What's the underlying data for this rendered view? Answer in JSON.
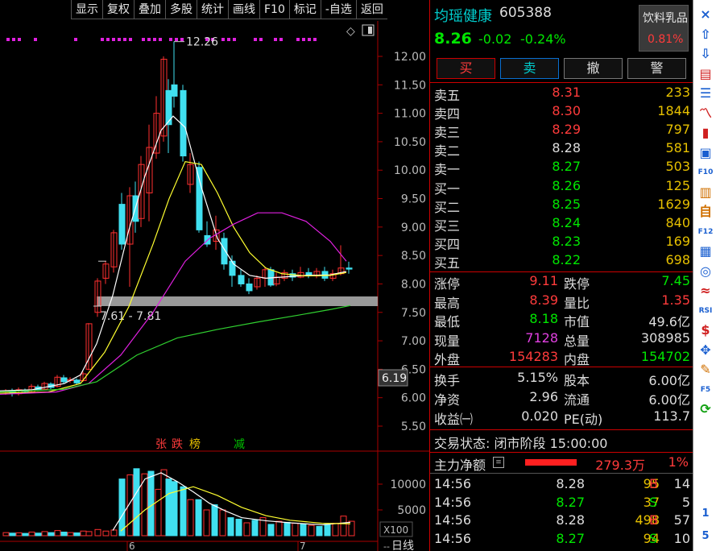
{
  "toolbar": {
    "items": [
      "显示",
      "复权",
      "叠加",
      "多股",
      "统计",
      "画线",
      "F10",
      "标记",
      "-自选",
      "返回"
    ]
  },
  "chart": {
    "price_ticks": [
      "12.00",
      "11.50",
      "11.00",
      "10.50",
      "10.00",
      "9.50",
      "9.00",
      "8.50",
      "8.00",
      "7.50",
      "7.00",
      "6.50",
      "6.00",
      "5.50"
    ],
    "high_label": "12.26",
    "range_label": "7.61 - 7.81",
    "current_tag": "6.19",
    "vol_ticks": [
      "10000",
      "5000"
    ],
    "vol_unit": "X100",
    "month_labels": [
      "6",
      "7"
    ],
    "period": "日线",
    "corner": "--",
    "markers": [
      {
        "text": "张",
        "color": "#ff3b3b"
      },
      {
        "text": "跌",
        "color": "#ff3b3b"
      },
      {
        "text": "榜",
        "color": "#e6c000"
      },
      {
        "text": "减",
        "color": "#00c000"
      }
    ]
  },
  "quote": {
    "name": "均瑶健康",
    "code": "605388",
    "industry": "饮料乳品",
    "industry_pct": "0.81%",
    "price": "8.26",
    "change": "-0.02",
    "change_pct": "-0.24%",
    "buttons": [
      {
        "label": "买",
        "color": "#ff3b3b",
        "border": "#c00"
      },
      {
        "label": "卖",
        "color": "#00cccc",
        "border": "#0a6fd0"
      },
      {
        "label": "撤",
        "color": "#ddd",
        "border": "#777"
      },
      {
        "label": "警",
        "color": "#ddd",
        "border": "#777"
      }
    ],
    "sell": [
      {
        "label": "卖五",
        "price": "8.31",
        "vol": "233",
        "pc": "#ff3b3b"
      },
      {
        "label": "卖四",
        "price": "8.30",
        "vol": "1844",
        "pc": "#ff3b3b"
      },
      {
        "label": "卖三",
        "price": "8.29",
        "vol": "797",
        "pc": "#ff3b3b"
      },
      {
        "label": "卖二",
        "price": "8.28",
        "vol": "581",
        "pc": "#ddd"
      },
      {
        "label": "卖一",
        "price": "8.27",
        "vol": "503",
        "pc": "#00e600"
      }
    ],
    "buy": [
      {
        "label": "买一",
        "price": "8.26",
        "vol": "125",
        "pc": "#00e600"
      },
      {
        "label": "买二",
        "price": "8.25",
        "vol": "1629",
        "pc": "#00e600"
      },
      {
        "label": "买三",
        "price": "8.24",
        "vol": "840",
        "pc": "#00e600"
      },
      {
        "label": "买四",
        "price": "8.23",
        "vol": "169",
        "pc": "#00e600"
      },
      {
        "label": "买五",
        "price": "8.22",
        "vol": "698",
        "pc": "#00e600"
      }
    ],
    "stats": [
      {
        "l1": "涨停",
        "v1": "9.11",
        "c1": "#ff3b3b",
        "l2": "跌停",
        "v2": "7.45",
        "c2": "#00e600"
      },
      {
        "l1": "最高",
        "v1": "8.39",
        "c1": "#ff3b3b",
        "l2": "量比",
        "v2": "1.35",
        "c2": "#ff3b3b"
      },
      {
        "l1": "最低",
        "v1": "8.18",
        "c1": "#00e600",
        "l2": "市值",
        "v2": "49.6亿",
        "c2": "#ddd"
      },
      {
        "l1": "现量",
        "v1": "7128",
        "c1": "#e040e0",
        "l2": "总量",
        "v2": "308985",
        "c2": "#ddd"
      },
      {
        "l1": "外盘",
        "v1": "154283",
        "c1": "#ff3b3b",
        "l2": "内盘",
        "v2": "154702",
        "c2": "#00e600"
      }
    ],
    "stats2": [
      {
        "l1": "换手",
        "v1": "5.15%",
        "l2": "股本",
        "v2": "6.00亿"
      },
      {
        "l1": "净资",
        "v1": "2.96",
        "l2": "流通",
        "v2": "6.00亿"
      },
      {
        "l1": "收益㈠",
        "v1": "0.020",
        "l2": "PE(动)",
        "v2": "113.7"
      }
    ],
    "status": "交易状态: 闭市阶段 15:00:00",
    "flow_label": "主力净额",
    "flow_value": "279.3万",
    "flow_pct": "1%",
    "ticks": [
      {
        "time": "14:56",
        "price": "8.28",
        "pc": "#ddd",
        "vol": "95",
        "side": "B",
        "sc": "#ff3b3b",
        "n": "14"
      },
      {
        "time": "14:56",
        "price": "8.27",
        "pc": "#00e600",
        "vol": "37",
        "side": "S",
        "sc": "#00e600",
        "n": "5"
      },
      {
        "time": "14:56",
        "price": "8.28",
        "pc": "#ddd",
        "vol": "498",
        "side": "B",
        "sc": "#ff3b3b",
        "n": "57"
      },
      {
        "time": "14:56",
        "price": "8.27",
        "pc": "#00e600",
        "vol": "94",
        "side": "S",
        "sc": "#00e600",
        "n": "10"
      }
    ]
  },
  "rightbar": {
    "icons": [
      {
        "name": "close-icon",
        "glyph": "×",
        "color": "#1a5fd0"
      },
      {
        "name": "arrow-up-icon",
        "glyph": "⇧",
        "color": "#1a5fd0"
      },
      {
        "name": "arrow-down-icon",
        "glyph": "⇩",
        "color": "#1a5fd0"
      },
      {
        "name": "board-icon",
        "glyph": "▤",
        "color": "#d02020"
      },
      {
        "name": "list-icon",
        "glyph": "☰",
        "color": "#1a5fd0"
      },
      {
        "name": "line-chart-icon",
        "glyph": "〽",
        "color": "#d02020"
      },
      {
        "name": "candle-icon",
        "glyph": "▮",
        "color": "#d02020"
      },
      {
        "name": "doc-icon",
        "glyph": "▣",
        "color": "#1a5fd0"
      },
      {
        "name": "f10-icon",
        "glyph": "F10",
        "color": "#1a5fd0"
      },
      {
        "name": "news-icon",
        "glyph": "▥",
        "color": "#d07000"
      },
      {
        "name": "self-select-icon",
        "glyph": "自",
        "color": "#d07000"
      },
      {
        "name": "f12-icon",
        "glyph": "F12",
        "color": "#1a5fd0"
      },
      {
        "name": "grid-icon",
        "glyph": "▦",
        "color": "#1a5fd0"
      },
      {
        "name": "circle-icon",
        "glyph": "◎",
        "color": "#1a5fd0"
      },
      {
        "name": "wave-icon",
        "glyph": "≈",
        "color": "#d02020"
      },
      {
        "name": "rsi-icon",
        "glyph": "RSI",
        "color": "#1a5fd0"
      },
      {
        "name": "dollar-icon",
        "glyph": "$",
        "color": "#d02020"
      },
      {
        "name": "move-icon",
        "glyph": "✥",
        "color": "#1a5fd0"
      },
      {
        "name": "pen-icon",
        "glyph": "✎",
        "color": "#d07000"
      },
      {
        "name": "f5-icon",
        "glyph": "F5",
        "color": "#1a5fd0"
      },
      {
        "name": "refresh-icon",
        "glyph": "⟳",
        "color": "#10a010"
      }
    ],
    "page_num": "1",
    "page_total": "5"
  }
}
